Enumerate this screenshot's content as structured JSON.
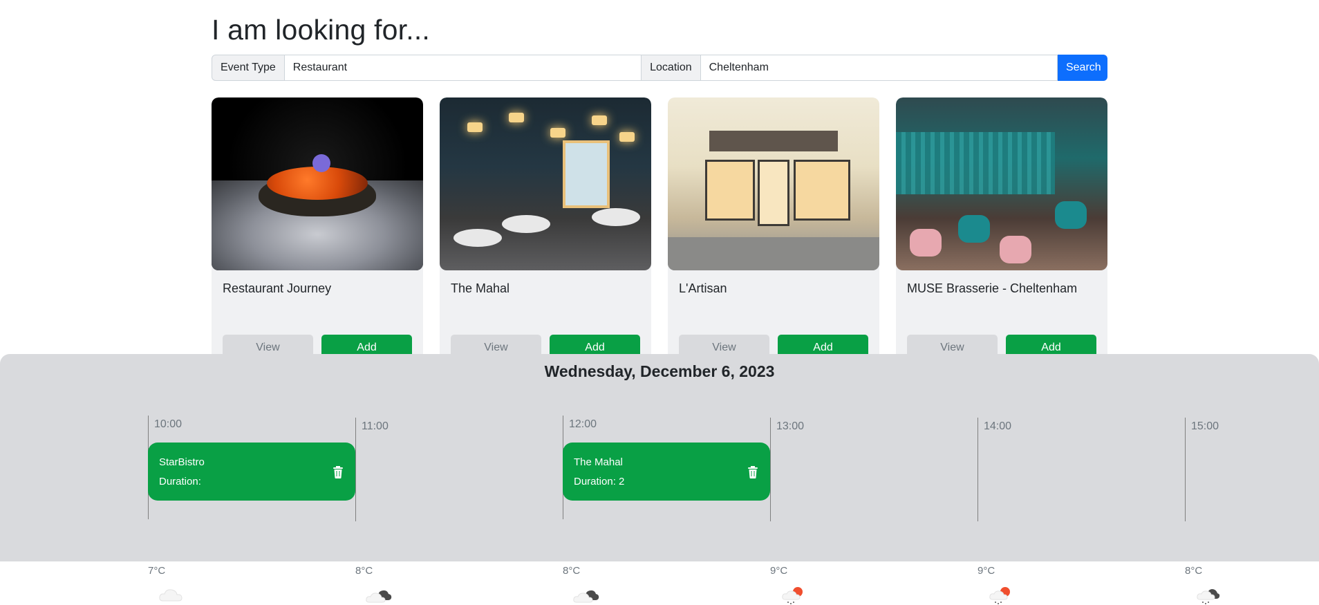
{
  "heading": "I am looking for...",
  "search": {
    "event_type_label": "Event Type",
    "event_type_value": "Restaurant",
    "location_label": "Location",
    "location_value": "Cheltenham",
    "button": "Search"
  },
  "cards": [
    {
      "title": "Restaurant Journey",
      "view": "View",
      "add": "Add"
    },
    {
      "title": "The Mahal",
      "view": "View",
      "add": "Add"
    },
    {
      "title": "L'Artisan",
      "view": "View",
      "add": "Add"
    },
    {
      "title": "MUSE Brasserie - Cheltenham",
      "view": "View",
      "add": "Add"
    }
  ],
  "schedule": {
    "date": "Wednesday, December 6, 2023",
    "slots": [
      {
        "time": "10:00",
        "temp": "7°C",
        "weather_icon": "cloud-icon"
      },
      {
        "time": "11:00",
        "temp": "8°C",
        "weather_icon": "partly-cloudy-icon"
      },
      {
        "time": "12:00",
        "temp": "8°C",
        "weather_icon": "partly-cloudy-icon"
      },
      {
        "time": "13:00",
        "temp": "9°C",
        "weather_icon": "sun-rain-icon"
      },
      {
        "time": "14:00",
        "temp": "9°C",
        "weather_icon": "sun-rain-icon"
      },
      {
        "time": "15:00",
        "temp": "8°C",
        "weather_icon": "cloud-rain-icon"
      }
    ],
    "events": [
      {
        "name": "StarBistro",
        "duration": "Duration:"
      },
      {
        "name": "The Mahal",
        "duration": "Duration: 2"
      }
    ]
  },
  "colors": {
    "primary": "#0d6efd",
    "success": "#09a045",
    "panel": "#d9dadd",
    "card": "#f0f1f3"
  }
}
